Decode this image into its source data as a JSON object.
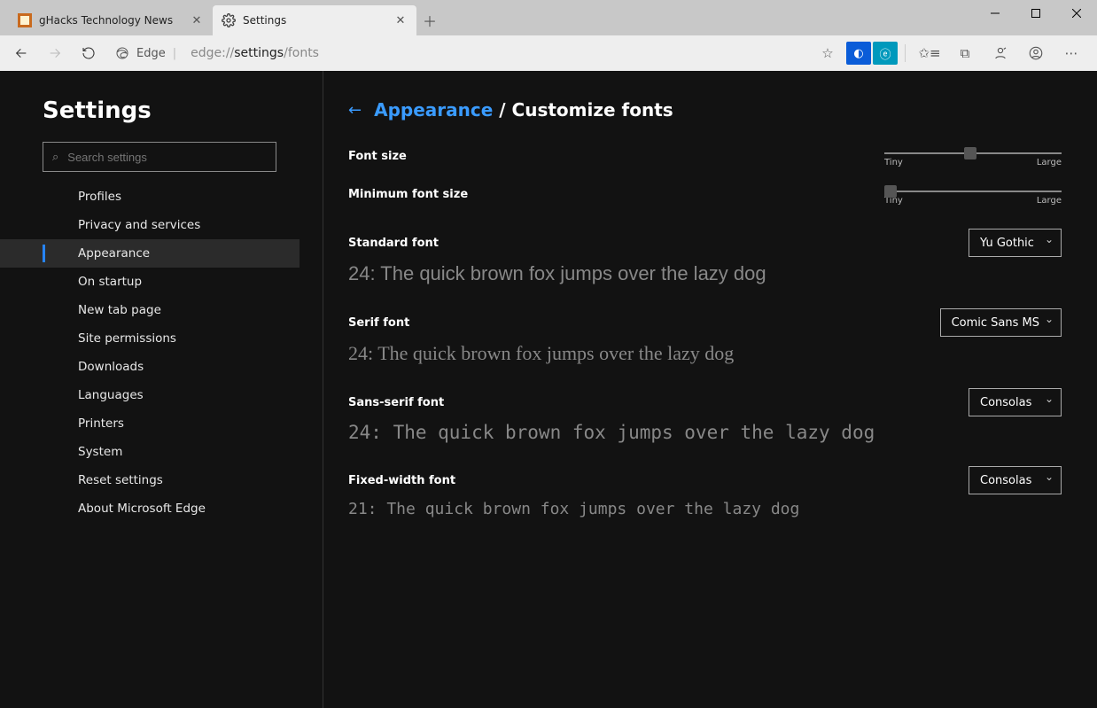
{
  "tabs": [
    {
      "title": "gHacks Technology News",
      "active": false
    },
    {
      "title": "Settings",
      "active": true
    }
  ],
  "addressbar": {
    "identity_label": "Edge",
    "url_scheme": "edge://",
    "url_path_bold": "settings",
    "url_path_rest": "/fonts"
  },
  "sidebar": {
    "title": "Settings",
    "search_placeholder": "Search settings",
    "items": [
      "Profiles",
      "Privacy and services",
      "Appearance",
      "On startup",
      "New tab page",
      "Site permissions",
      "Downloads",
      "Languages",
      "Printers",
      "System",
      "Reset settings",
      "About Microsoft Edge"
    ],
    "active_index": 2
  },
  "breadcrumb": {
    "link": "Appearance",
    "current": "Customize fonts"
  },
  "sliders": {
    "font_size": {
      "label": "Font size",
      "min_label": "Tiny",
      "max_label": "Large",
      "position_pct": 45
    },
    "min_font_size": {
      "label": "Minimum font size",
      "min_label": "Tiny",
      "max_label": "Large",
      "position_pct": 0
    }
  },
  "fonts": {
    "standard": {
      "label": "Standard font",
      "value": "Yu Gothic",
      "sample": "24: The quick brown fox jumps over the lazy dog"
    },
    "serif": {
      "label": "Serif font",
      "value": "Comic Sans MS",
      "sample": "24:  The quick brown fox jumps over the lazy dog"
    },
    "sans": {
      "label": "Sans-serif font",
      "value": "Consolas",
      "sample": "24:  The quick brown fox jumps over the lazy dog"
    },
    "fixed": {
      "label": "Fixed-width font",
      "value": "Consolas",
      "sample": "21:  The quick brown fox jumps over the lazy dog"
    }
  }
}
